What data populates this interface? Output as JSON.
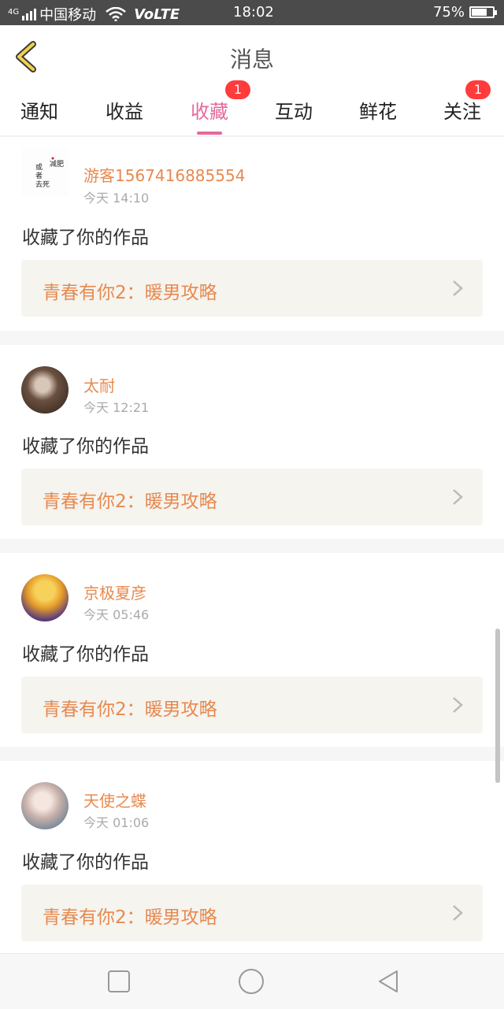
{
  "status_bar": {
    "network": "4G",
    "carrier": "中国移动",
    "volte": "VoLTE",
    "time": "18:02",
    "battery": "75%",
    "battery_level": 0.75
  },
  "header": {
    "back_icon": "chevron-left-icon",
    "title": "消息"
  },
  "tabs": [
    {
      "label": "通知",
      "badge": "",
      "active": false
    },
    {
      "label": "收益",
      "badge": "",
      "active": false
    },
    {
      "label": "收藏",
      "badge": "1",
      "active": true
    },
    {
      "label": "互动",
      "badge": "",
      "active": false
    },
    {
      "label": "鲜花",
      "badge": "",
      "active": false
    },
    {
      "label": "关注",
      "badge": "1",
      "active": false
    }
  ],
  "feed": [
    {
      "user": "游客1567416885554",
      "time": "今天 14:10",
      "action": "收藏了你的作品",
      "work": "青春有你2：暖男攻略",
      "avatar_text": "减肥 或者去死"
    },
    {
      "user": "太耐",
      "time": "今天 12:21",
      "action": "收藏了你的作品",
      "work": "青春有你2：暖男攻略"
    },
    {
      "user": "京极夏彦",
      "time": "今天 05:46",
      "action": "收藏了你的作品",
      "work": "青春有你2：暖男攻略"
    },
    {
      "user": "天使之蝶",
      "time": "今天 01:06",
      "action": "收藏了你的作品",
      "work": "青春有你2：暖男攻略"
    }
  ],
  "nav_bar": {
    "recents_icon": "square-icon",
    "home_icon": "circle-icon",
    "back_icon": "triangle-back-icon"
  },
  "colors": {
    "accent_pink": "#e36a9c",
    "name_orange": "#e8894e",
    "badge_red": "#ff3b3b",
    "back_chevron": "#f2d24a"
  }
}
